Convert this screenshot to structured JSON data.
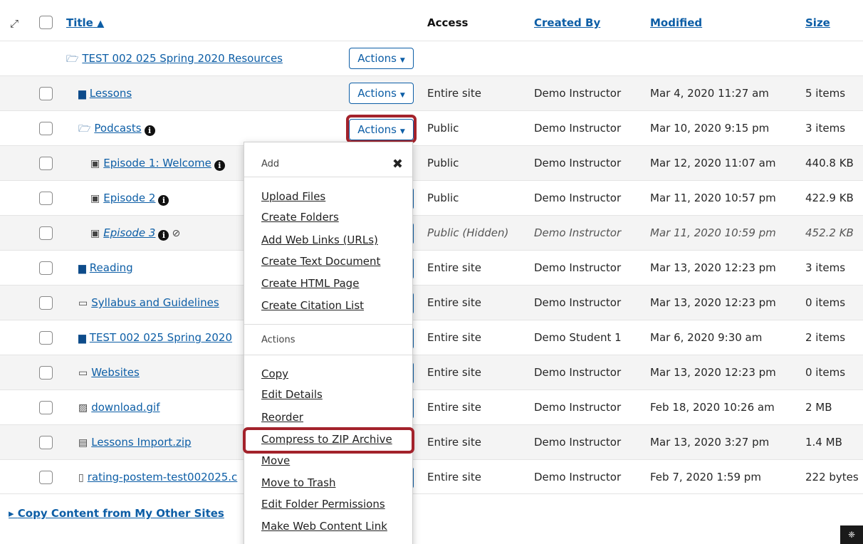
{
  "header": {
    "expand_icon": "expand-arrows-icon",
    "title": "Title",
    "title_sort_icon": "^",
    "access": "Access",
    "created_by": "Created By",
    "modified": "Modified",
    "size": "Size"
  },
  "root": {
    "title": "TEST 002 025 Spring 2020 Resources",
    "actions_label": "Actions"
  },
  "rows": [
    {
      "title": "Lessons",
      "access": "Entire site",
      "created_by": "Demo Instructor",
      "modified": "Mar 4, 2020 11:27 am",
      "size": "5 items"
    },
    {
      "title": "Podcasts",
      "access": "Public",
      "created_by": "Demo Instructor",
      "modified": "Mar 10, 2020 9:15 pm",
      "size": "3 items"
    },
    {
      "title": "Episode 1: Welcome",
      "access": "Public",
      "created_by": "Demo Instructor",
      "modified": "Mar 12, 2020 11:07 am",
      "size": "440.8 KB"
    },
    {
      "title": "Episode 2",
      "access": "Public",
      "created_by": "Demo Instructor",
      "modified": "Mar 11, 2020 10:57 pm",
      "size": "422.9 KB"
    },
    {
      "title": "Episode 3",
      "access": "Public (Hidden)",
      "created_by": "Demo Instructor",
      "modified": "Mar 11, 2020 10:59 pm",
      "size": "452.2 KB"
    },
    {
      "title": "Reading",
      "access": "Entire site",
      "created_by": "Demo Instructor",
      "modified": "Mar 13, 2020 12:23 pm",
      "size": "3 items"
    },
    {
      "title": "Syllabus and Guidelines",
      "access": "Entire site",
      "created_by": "Demo Instructor",
      "modified": "Mar 13, 2020 12:23 pm",
      "size": "0 items"
    },
    {
      "title": "TEST 002 025 Spring 2020",
      "access": "Entire site",
      "created_by": "Demo Student 1",
      "modified": "Mar 6, 2020 9:30 am",
      "size": "2 items"
    },
    {
      "title": "Websites",
      "access": "Entire site",
      "created_by": "Demo Instructor",
      "modified": "Mar 13, 2020 12:23 pm",
      "size": "0 items"
    },
    {
      "title": "download.gif",
      "access": "Entire site",
      "created_by": "Demo Instructor",
      "modified": "Feb 18, 2020 10:26 am",
      "size": "2 MB"
    },
    {
      "title": "Lessons Import.zip",
      "access": "Entire site",
      "created_by": "Demo Instructor",
      "modified": "Mar 13, 2020 3:27 pm",
      "size": "1.4 MB"
    },
    {
      "title": "rating-postem-test002025.c",
      "access": "Entire site",
      "created_by": "Demo Instructor",
      "modified": "Feb 7, 2020 1:59 pm",
      "size": "222 bytes"
    }
  ],
  "menu": {
    "add_heading": "Add",
    "close_icon": "close-icon",
    "add_items": [
      "Upload Files",
      "Create Folders",
      "Add Web Links (URLs)",
      "Create Text Document",
      "Create HTML Page",
      "Create Citation List"
    ],
    "actions_heading": "Actions",
    "action_items": [
      "Copy",
      "Edit Details",
      "Reorder",
      "Compress to ZIP Archive",
      "Move",
      "Move to Trash",
      "Edit Folder Permissions",
      "Make Web Content Link"
    ]
  },
  "footer": {
    "copy_content_link": "Copy Content from My Other Sites"
  },
  "colors": {
    "link": "#0d5ea6",
    "highlight": "#a3222b"
  }
}
